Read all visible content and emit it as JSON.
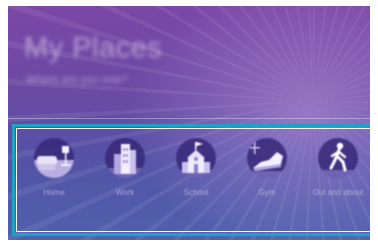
{
  "header": {
    "title": "My Places",
    "subtitle": "Where are you now?"
  },
  "places": [
    {
      "label": "Home",
      "icon": "home-icon"
    },
    {
      "label": "Work",
      "icon": "work-icon"
    },
    {
      "label": "School",
      "icon": "school-icon"
    },
    {
      "label": "Gym",
      "icon": "gym-icon"
    },
    {
      "label": "Out and about",
      "icon": "walking-icon"
    }
  ],
  "colors": {
    "background_top": "#7a47a6",
    "background_bottom": "#4f61ad",
    "highlight_border": "#1aa3c6",
    "icon_circle": "#37287a"
  }
}
